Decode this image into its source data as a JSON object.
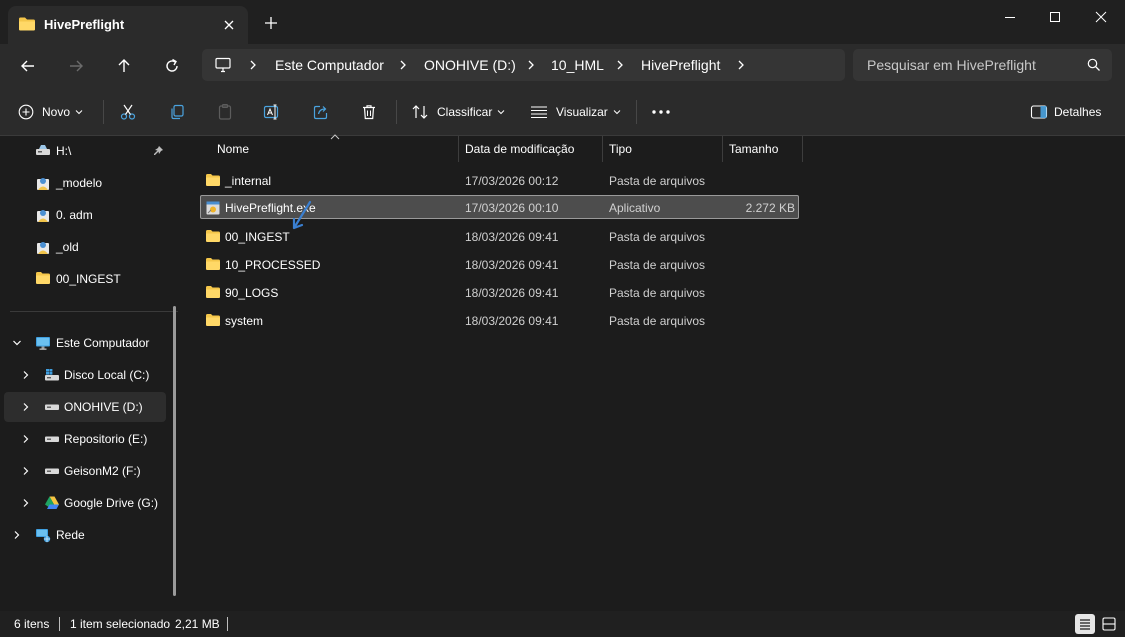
{
  "window": {
    "tab_title": "HivePreflight",
    "icons": {
      "tab": "folder-icon",
      "close_tab": "close-icon",
      "new_tab": "plus-icon",
      "minimize": "minimize-icon",
      "maximize": "maximize-icon",
      "close": "close-icon"
    }
  },
  "nav": {
    "breadcrumb": [
      "Este Computador",
      "ONOHIVE (D:)",
      "10_HML",
      "HivePreflight"
    ],
    "search_placeholder": "Pesquisar em HivePreflight"
  },
  "commandbar": {
    "new_label": "Novo",
    "sort_label": "Classificar",
    "view_label": "Visualizar",
    "details_label": "Detalhes",
    "tool_icons": [
      "cut-icon",
      "copy-icon",
      "paste-icon",
      "rename-icon",
      "share-icon",
      "delete-icon",
      "more-icon"
    ]
  },
  "sidebar": {
    "pinned": [
      {
        "label": "H:\\",
        "icon": "network-drive-icon"
      },
      {
        "label": "_modelo",
        "icon": "user-folder-icon"
      },
      {
        "label": "0. adm",
        "icon": "user-folder-icon"
      },
      {
        "label": "_old",
        "icon": "user-folder-icon"
      },
      {
        "label": "00_INGEST",
        "icon": "folder-icon"
      }
    ],
    "this_pc": "Este Computador",
    "drives": [
      {
        "label": "Disco Local (C:)",
        "icon": "windows-drive-icon"
      },
      {
        "label": "ONOHIVE (D:)",
        "icon": "drive-icon"
      },
      {
        "label": "Repositorio (E:)",
        "icon": "drive-icon"
      },
      {
        "label": "GeisonM2 (F:)",
        "icon": "drive-icon"
      },
      {
        "label": "Google Drive (G:)",
        "icon": "google-drive-icon"
      }
    ],
    "network": "Rede"
  },
  "filelist": {
    "columns": [
      "Nome",
      "Data de modificação",
      "Tipo",
      "Tamanho"
    ],
    "rows": [
      {
        "name": "_internal",
        "date": "17/03/2026 00:12",
        "type": "Pasta de arquivos",
        "size": "",
        "icon": "folder-icon"
      },
      {
        "name": "HivePreflight.exe",
        "date": "17/03/2026 00:10",
        "type": "Aplicativo",
        "size": "2.272 KB",
        "icon": "exe-icon"
      },
      {
        "name": "00_INGEST",
        "date": "18/03/2026 09:41",
        "type": "Pasta de arquivos",
        "size": "",
        "icon": "folder-icon"
      },
      {
        "name": "10_PROCESSED",
        "date": "18/03/2026 09:41",
        "type": "Pasta de arquivos",
        "size": "",
        "icon": "folder-icon"
      },
      {
        "name": "90_LOGS",
        "date": "18/03/2026 09:41",
        "type": "Pasta de arquivos",
        "size": "",
        "icon": "folder-icon"
      },
      {
        "name": "system",
        "date": "18/03/2026 09:41",
        "type": "Pasta de arquivos",
        "size": "",
        "icon": "folder-icon"
      }
    ]
  },
  "status": {
    "item_count": "6 itens",
    "selection": "1 item selecionado",
    "selection_size": "2,21 MB"
  },
  "colors": {
    "background": "#1c1c1c",
    "chrome": "#2b2b2b",
    "folder": "#f4c64a",
    "accent": "#4aa3df"
  }
}
